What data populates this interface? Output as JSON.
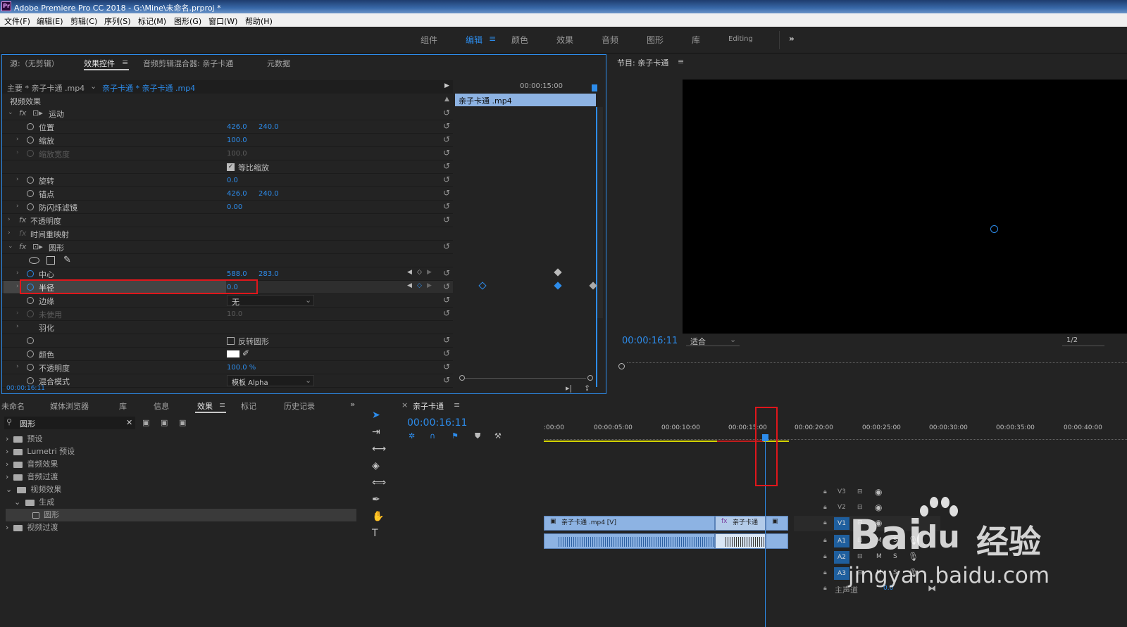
{
  "window": {
    "title": "Adobe Premiere Pro CC 2018 - G:\\Mine\\未命名.prproj *",
    "app_icon": "Pr"
  },
  "menu": [
    "文件(F)",
    "编辑(E)",
    "剪辑(C)",
    "序列(S)",
    "标记(M)",
    "图形(G)",
    "窗口(W)",
    "帮助(H)"
  ],
  "workspaces": {
    "items": [
      "组件",
      "编辑",
      "颜色",
      "效果",
      "音频",
      "图形",
      "库",
      "Editing"
    ],
    "active": "编辑",
    "more": "»"
  },
  "source_panel": {
    "tabs": [
      "源:（无剪辑）",
      "效果控件",
      "音频剪辑混合器: 亲子卡通",
      "元数据"
    ],
    "active_tab": "效果控件",
    "master_label": "主要 * 亲子卡通 .mp4",
    "clip_label": "亲子卡通 * 亲子卡通 .mp4",
    "section": "视频效果",
    "ruler_time": "00:00:15:00",
    "clip_bar": "亲子卡通 .mp4",
    "current_time": "00:00:16:11",
    "uniform_scale_label": "等比缩放",
    "invert_label": "反转圆形",
    "props": {
      "motion": "运动",
      "position": {
        "label": "位置",
        "x": "426.0",
        "y": "240.0"
      },
      "scale": {
        "label": "缩放",
        "value": "100.0"
      },
      "scale_width": {
        "label": "缩放宽度",
        "value": "100.0"
      },
      "rotation": {
        "label": "旋转",
        "value": "0.0"
      },
      "anchor": {
        "label": "锚点",
        "x": "426.0",
        "y": "240.0"
      },
      "antiflicker": {
        "label": "防闪烁滤镜",
        "value": "0.00"
      },
      "opacity": "不透明度",
      "time_remap": "时间重映射",
      "circle": "圆形",
      "center": {
        "label": "中心",
        "x": "588.0",
        "y": "283.0"
      },
      "radius": {
        "label": "半径",
        "value": "0.0"
      },
      "edge": {
        "label": "边缘",
        "value": "无"
      },
      "unused": {
        "label": "未使用",
        "value": "10.0"
      },
      "feather": "羽化",
      "color": "颜色",
      "opacity2": {
        "label": "不透明度",
        "value": "100.0 %"
      },
      "blend": {
        "label": "混合模式",
        "value": "模板 Alpha"
      }
    }
  },
  "program_monitor": {
    "title": "节目: 亲子卡通",
    "timecode": "00:00:16:11",
    "fit": "适合",
    "resolution": "1/2"
  },
  "project_panel": {
    "tabs": [
      "未命名",
      "媒体浏览器",
      "库",
      "信息",
      "效果",
      "标记",
      "历史记录"
    ],
    "active_tab": "效果",
    "search": "圆形",
    "tree": [
      "预设",
      "Lumetri 预设",
      "音频效果",
      "音频过渡",
      "视频效果",
      "生成",
      "圆形",
      "视频过渡"
    ]
  },
  "timeline": {
    "title": "亲子卡通",
    "timecode": "00:00:16:11",
    "ruler": [
      ":00:00",
      "00:00:05:00",
      "00:00:10:00",
      "00:00:15:00",
      "00:00:20:00",
      "00:00:25:00",
      "00:00:30:00",
      "00:00:35:00",
      "00:00:40:00"
    ],
    "tracks": [
      "V3",
      "V2",
      "V1",
      "A1",
      "A2",
      "A3"
    ],
    "master": "主声道",
    "master_value": "0.0",
    "clip1": "亲子卡通 .mp4 [V]",
    "clip2": "亲子卡通"
  },
  "watermark": {
    "brand": "Bai",
    "brand2": "du",
    "cn": "经验",
    "url": "jingyan.baidu.com"
  }
}
